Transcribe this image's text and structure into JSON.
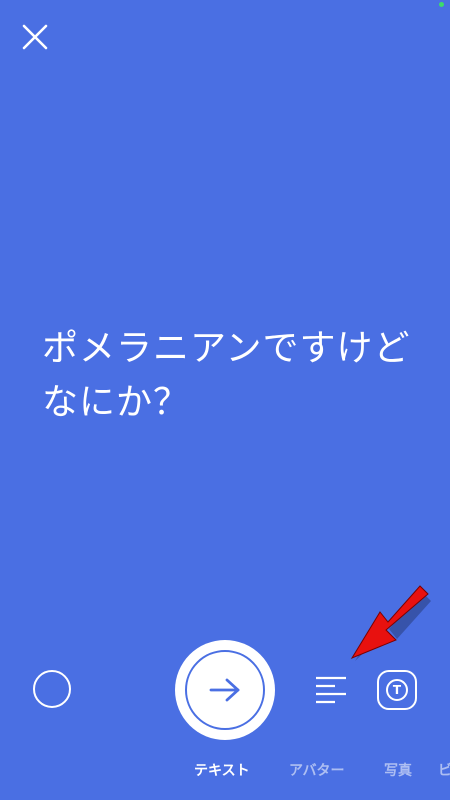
{
  "colors": {
    "background": "#4a6fe3",
    "foreground": "#ffffff",
    "annotation_arrow": "#e8110f"
  },
  "toolbar": {
    "close_icon": "close-icon",
    "color_picker_icon": "color-circle-icon",
    "send_icon": "arrow-right-icon",
    "align_icon": "text-align-left-icon",
    "font_icon": "text-style-icon",
    "font_icon_letter": "T"
  },
  "story": {
    "text": "ポメラニアンですけどなにか？"
  },
  "modes": [
    {
      "label": "テキスト",
      "selected": true
    },
    {
      "label": "アバター",
      "selected": false
    },
    {
      "label": "写真",
      "selected": false
    },
    {
      "label": "ビ",
      "selected": false
    }
  ]
}
